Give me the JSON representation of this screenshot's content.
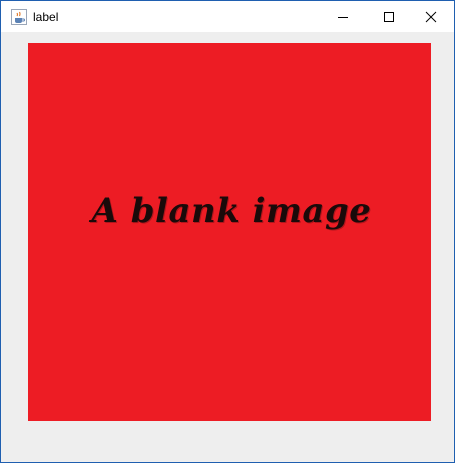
{
  "window": {
    "title": "label",
    "icon": "java-coffee-cup-icon",
    "controls": {
      "minimize_icon": "minimize-icon",
      "maximize_icon": "maximize-icon",
      "close_icon": "close-icon"
    }
  },
  "content": {
    "image": {
      "caption": "A blank image",
      "background_color": "#ed1c24",
      "text_color": "#1a0a0a"
    },
    "panel_background": "#eeeeee"
  }
}
